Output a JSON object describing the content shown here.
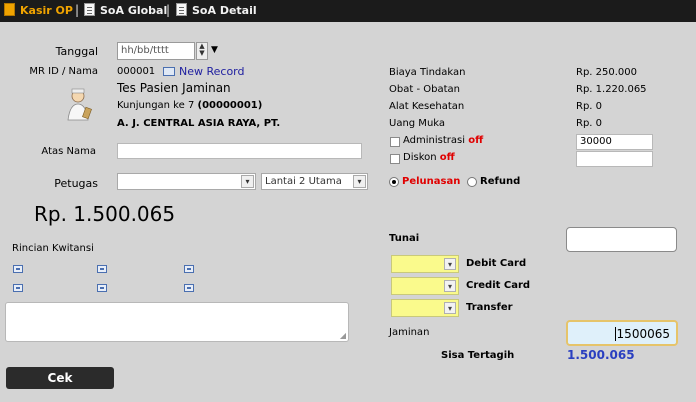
{
  "topbar": {
    "tabs": [
      {
        "label": "Kasir OP",
        "active": true,
        "icon": "cashier-icon"
      },
      {
        "label": "SoA Global",
        "active": false,
        "icon": "document-icon"
      },
      {
        "label": "SoA Detail",
        "active": false,
        "icon": "document-icon"
      }
    ],
    "separator": "|"
  },
  "form": {
    "tanggal_label": "Tanggal",
    "tanggal_placeholder": "hh/bb/tttt",
    "mrid_label": "MR ID / Nama",
    "mrid_value": "000001",
    "new_record": "New Record",
    "patient_name": "Tes Pasien Jaminan",
    "kunjungan_prefix": "Kunjungan ke 7",
    "kunjungan_code": "(00000001)",
    "company": "A. J. CENTRAL ASIA RAYA, PT.",
    "atas_nama_label": "Atas Nama",
    "petugas_label": "Petugas",
    "lantai_value": "Lantai 2 Utama",
    "total": "Rp. 1.500.065",
    "rincian_label": "Rincian Kwitansi"
  },
  "billing": {
    "rows": [
      {
        "label": "Biaya Tindakan",
        "value": "Rp. 250.000"
      },
      {
        "label": "Obat - Obatan",
        "value": "Rp. 1.220.065"
      },
      {
        "label": "Alat Kesehatan",
        "value": "Rp. 0"
      },
      {
        "label": "Uang Muka",
        "value": "Rp. 0"
      }
    ],
    "administrasi_label": "Administrasi",
    "administrasi_value": "30000",
    "diskon_label": "Diskon",
    "off_label": "off",
    "pelunasan_label": "Pelunasan",
    "refund_label": "Refund",
    "tunai_label": "Tunai",
    "debit_label": "Debit Card",
    "credit_label": "Credit Card",
    "transfer_label": "Transfer",
    "jaminan_label": "Jaminan",
    "jaminan_value": "1500065",
    "sisa_label": "Sisa Tertagih",
    "sisa_value": "1.500.065"
  },
  "buttons": {
    "cek": "Cek"
  },
  "colors": {
    "topbar_bg": "#1b1b1b",
    "active_tab": "#f0a300",
    "page_bg": "#d4d4d4",
    "accent_red": "#e00000",
    "accent_blue": "#2020a0",
    "yellow_select": "#fafa8c"
  }
}
